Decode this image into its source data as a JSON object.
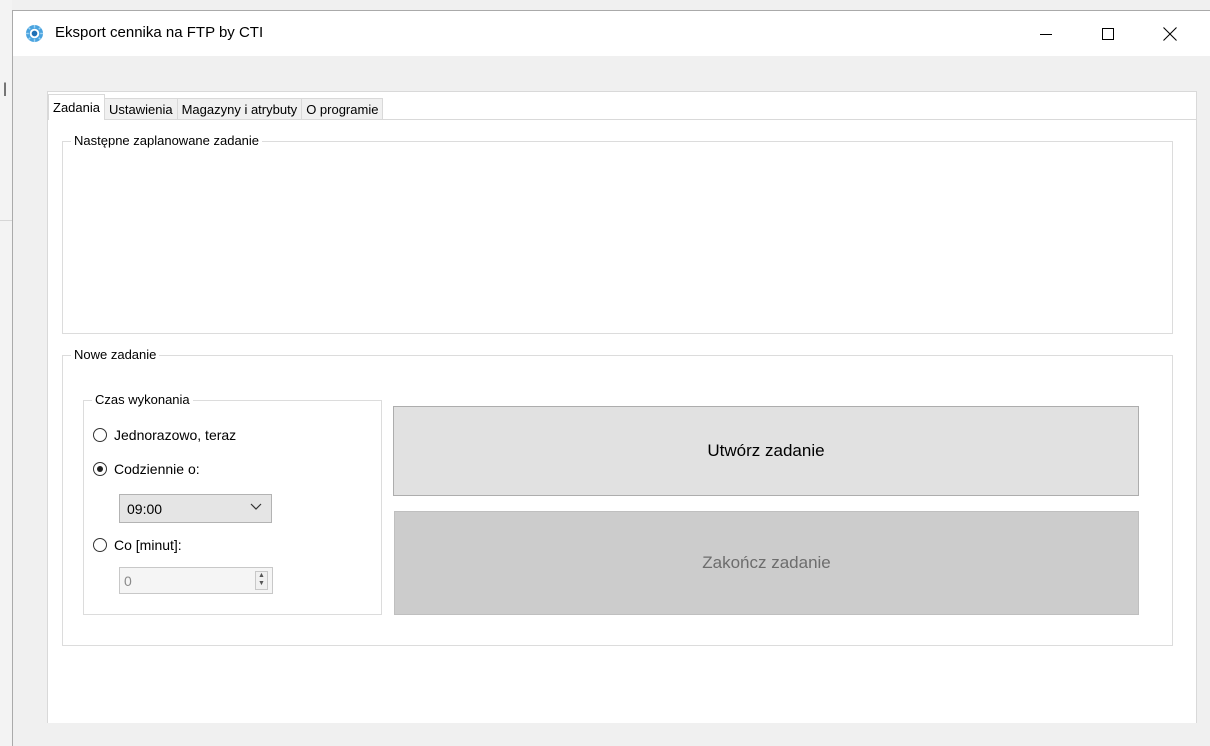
{
  "window": {
    "title": "Eksport cennika na FTP by CTI"
  },
  "tabs": [
    {
      "label": "Zadania",
      "active": true
    },
    {
      "label": "Ustawienia",
      "active": false
    },
    {
      "label": "Magazyny i atrybuty",
      "active": false
    },
    {
      "label": "O programie",
      "active": false
    }
  ],
  "next_task_group": {
    "legend": "Następne zaplanowane zadanie"
  },
  "new_task_group": {
    "legend": "Nowe zadanie",
    "time_group": {
      "legend": "Czas wykonania",
      "options": [
        {
          "label": "Jednorazowo, teraz",
          "checked": false
        },
        {
          "label": "Codziennie o:",
          "checked": true
        },
        {
          "label": "Co [minut]:",
          "checked": false
        }
      ],
      "daily_time": "09:00",
      "minutes_value": "0"
    },
    "create_button": "Utwórz zadanie",
    "end_button": "Zakończ zadanie"
  },
  "background": {
    "glyph": "l"
  }
}
